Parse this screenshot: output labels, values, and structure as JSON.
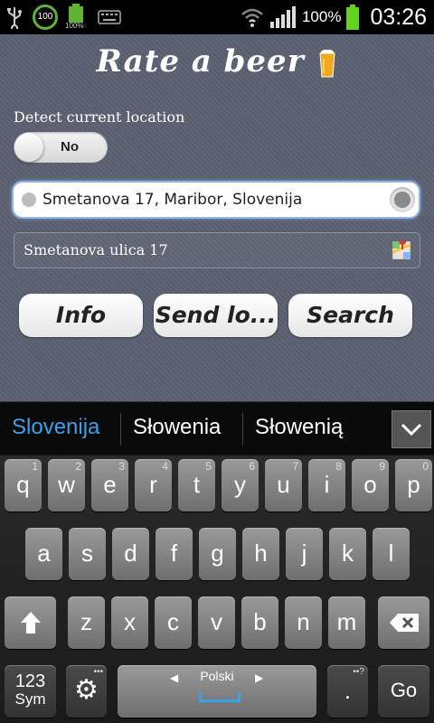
{
  "status_bar": {
    "icons_left": [
      "usb-icon",
      "battery-100-ring-icon",
      "battery-100-icon",
      "keyboard-icon"
    ],
    "ring_label": "100",
    "battery_small_label": "100%",
    "battery_percent": "100%",
    "time": "03:26"
  },
  "app": {
    "title": "Rate a beer",
    "detect_label": "Detect current location",
    "toggle_value": "No",
    "address": "Smetanova 17, Maribor, Slovenija",
    "street": "Smetanova ulica 17",
    "buttons": {
      "info": "Info",
      "send": "Send lo...",
      "search": "Search"
    }
  },
  "keyboard": {
    "suggestions": [
      "Slovenija",
      "Słowenia",
      "Słowenią"
    ],
    "row1": [
      {
        "k": "q",
        "n": "1"
      },
      {
        "k": "w",
        "n": "2"
      },
      {
        "k": "e",
        "n": "3"
      },
      {
        "k": "r",
        "n": "4"
      },
      {
        "k": "t",
        "n": "5"
      },
      {
        "k": "y",
        "n": "6"
      },
      {
        "k": "u",
        "n": "7"
      },
      {
        "k": "i",
        "n": "8"
      },
      {
        "k": "o",
        "n": "9"
      },
      {
        "k": "p",
        "n": "0"
      }
    ],
    "row2": [
      "a",
      "s",
      "d",
      "f",
      "g",
      "h",
      "j",
      "k",
      "l"
    ],
    "row3": [
      "z",
      "x",
      "c",
      "v",
      "b",
      "n",
      "m"
    ],
    "sym_top": "123",
    "sym_bottom": "Sym",
    "space_label": "Polski",
    "period": ".",
    "go": "Go",
    "accent_color": "#3aa0e8"
  }
}
